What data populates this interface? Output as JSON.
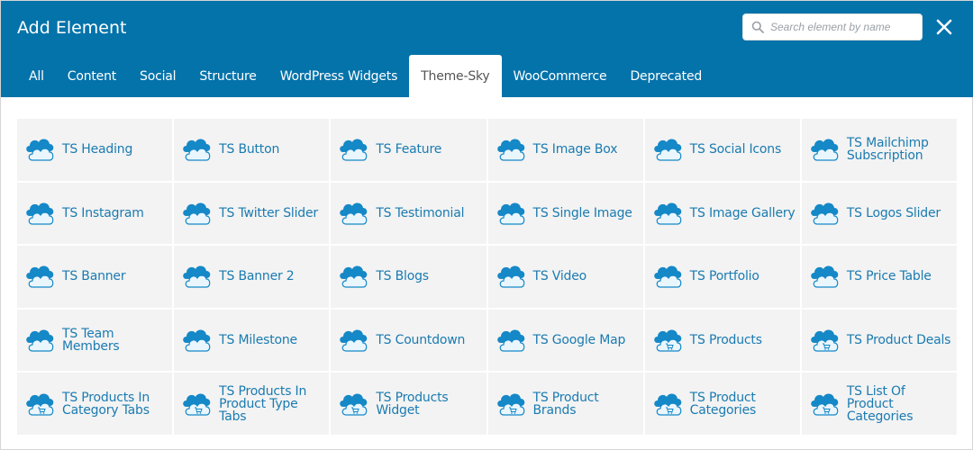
{
  "header": {
    "title": "Add Element",
    "bg_color": "#0473aa"
  },
  "search": {
    "placeholder": "Search element by name",
    "value": ""
  },
  "close": {
    "icon": "close-icon"
  },
  "tabs": [
    {
      "label": "All",
      "active": false
    },
    {
      "label": "Content",
      "active": false
    },
    {
      "label": "Social",
      "active": false
    },
    {
      "label": "Structure",
      "active": false
    },
    {
      "label": "WordPress Widgets",
      "active": false
    },
    {
      "label": "Theme-Sky",
      "active": true
    },
    {
      "label": "WooCommerce",
      "active": false
    },
    {
      "label": "Deprecated",
      "active": false
    }
  ],
  "elements": [
    {
      "label": "TS Heading",
      "icon": "cloud-icon",
      "slug": "ts-heading"
    },
    {
      "label": "TS Button",
      "icon": "cloud-icon",
      "slug": "ts-button"
    },
    {
      "label": "TS Feature",
      "icon": "cloud-icon",
      "slug": "ts-feature"
    },
    {
      "label": "TS Image Box",
      "icon": "cloud-icon",
      "slug": "ts-image-box"
    },
    {
      "label": "TS Social Icons",
      "icon": "cloud-icon",
      "slug": "ts-social-icons"
    },
    {
      "label": "TS Mailchimp\nSubscription",
      "icon": "cloud-icon",
      "slug": "ts-mailchimp-subscription"
    },
    {
      "label": "TS Instagram",
      "icon": "cloud-icon",
      "slug": "ts-instagram"
    },
    {
      "label": "TS Twitter Slider",
      "icon": "cloud-icon",
      "slug": "ts-twitter-slider"
    },
    {
      "label": "TS Testimonial",
      "icon": "cloud-icon",
      "slug": "ts-testimonial"
    },
    {
      "label": "TS Single Image",
      "icon": "cloud-icon",
      "slug": "ts-single-image"
    },
    {
      "label": "TS Image Gallery",
      "icon": "cloud-icon",
      "slug": "ts-image-gallery"
    },
    {
      "label": "TS Logos Slider",
      "icon": "cloud-icon",
      "slug": "ts-logos-slider"
    },
    {
      "label": "TS Banner",
      "icon": "cloud-icon",
      "slug": "ts-banner"
    },
    {
      "label": "TS Banner 2",
      "icon": "cloud-icon",
      "slug": "ts-banner-2"
    },
    {
      "label": "TS Blogs",
      "icon": "cloud-icon",
      "slug": "ts-blogs"
    },
    {
      "label": "TS Video",
      "icon": "cloud-icon",
      "slug": "ts-video"
    },
    {
      "label": "TS Portfolio",
      "icon": "cloud-icon",
      "slug": "ts-portfolio"
    },
    {
      "label": "TS Price Table",
      "icon": "cloud-icon",
      "slug": "ts-price-table"
    },
    {
      "label": "TS Team Members",
      "icon": "cloud-icon",
      "slug": "ts-team-members"
    },
    {
      "label": "TS Milestone",
      "icon": "cloud-icon",
      "slug": "ts-milestone"
    },
    {
      "label": "TS Countdown",
      "icon": "cloud-icon",
      "slug": "ts-countdown"
    },
    {
      "label": "TS Google Map",
      "icon": "cloud-icon",
      "slug": "ts-google-map"
    },
    {
      "label": "TS Products",
      "icon": "cloud-cart-icon",
      "slug": "ts-products"
    },
    {
      "label": "TS Product Deals",
      "icon": "cloud-cart-icon",
      "slug": "ts-product-deals"
    },
    {
      "label": "TS Products In\nCategory Tabs",
      "icon": "cloud-cart-icon",
      "slug": "ts-products-in-category-tabs"
    },
    {
      "label": "TS Products In\nProduct Type Tabs",
      "icon": "cloud-cart-icon",
      "slug": "ts-products-in-product-type-tabs"
    },
    {
      "label": "TS Products\nWidget",
      "icon": "cloud-cart-icon",
      "slug": "ts-products-widget"
    },
    {
      "label": "TS Product Brands",
      "icon": "cloud-cart-icon",
      "slug": "ts-product-brands"
    },
    {
      "label": "TS Product\nCategories",
      "icon": "cloud-cart-icon",
      "slug": "ts-product-categories"
    },
    {
      "label": "TS List Of Product\nCategories",
      "icon": "cloud-cart-icon",
      "slug": "ts-list-of-product-categories"
    }
  ]
}
